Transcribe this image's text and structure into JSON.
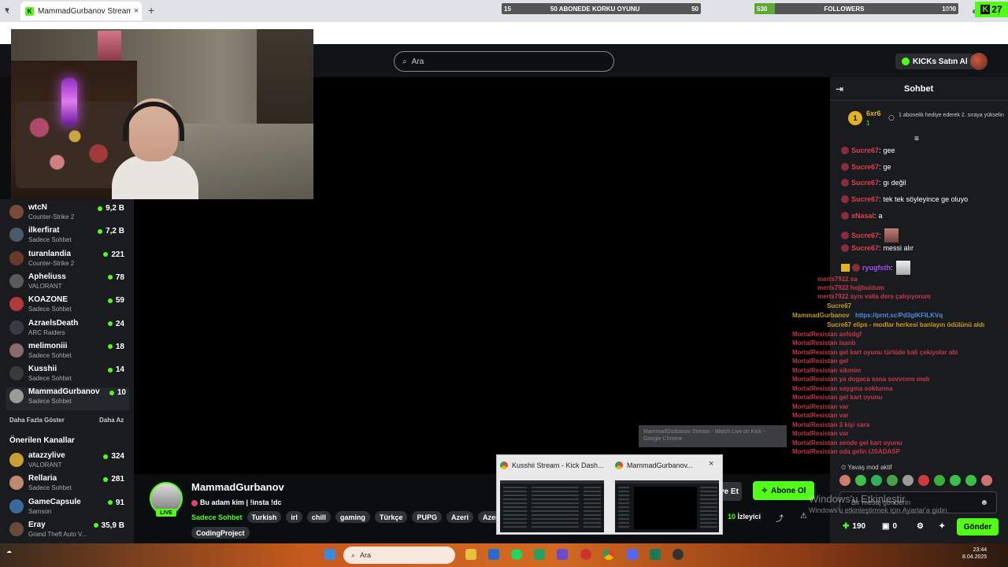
{
  "browser": {
    "tab_title": "MammadGurbanov Stream - W",
    "tab_icon": "kick-favicon",
    "new_tab": "+"
  },
  "overlays": {
    "goal1": {
      "min": "15",
      "label": "50 ABONEDE KORKU OYUNU",
      "max": "50",
      "progress": 0.0
    },
    "goal2": {
      "min": "530",
      "label": "FOLLOWERS",
      "max": "1000",
      "progress": 0.1
    },
    "kick_badge": "27"
  },
  "header": {
    "search_placeholder": "Ara",
    "kicks_button": "KICKs Satın Al"
  },
  "sidebar": {
    "following": [
      {
        "name": "wtcN",
        "category": "Counter-Strike 2",
        "viewers": "9,2 B",
        "avatar": "#7a4a3a"
      },
      {
        "name": "ilkerfirat",
        "category": "Sadece Sohbet",
        "viewers": "7,2 B",
        "avatar": "#4a5a6a"
      },
      {
        "name": "turanlandia",
        "category": "Counter-Strike 2",
        "viewers": "221",
        "avatar": "#6a3a2a"
      },
      {
        "name": "Apheliuss",
        "category": "VALORANT",
        "viewers": "78",
        "avatar": "#5a5a5a"
      },
      {
        "name": "KOAZONE",
        "category": "Sadece Sohbet",
        "viewers": "59",
        "avatar": "#b03a3a"
      },
      {
        "name": "AzraelsDeath",
        "category": "ARC Raiders",
        "viewers": "24",
        "avatar": "#3a3a4a"
      },
      {
        "name": "melimoniii",
        "category": "Sadece Sohbet",
        "viewers": "18",
        "avatar": "#8a6a6a"
      },
      {
        "name": "Kusshii",
        "category": "Sadece Sohbet",
        "viewers": "14",
        "avatar": "#3a3a3a"
      },
      {
        "name": "MammadGurbanov",
        "category": "Sadece Sohbet",
        "viewers": "10",
        "avatar": "#9a9a9a"
      }
    ],
    "show_more": "Daha Fazla Göster",
    "show_less": "Daha Az",
    "recommended_title": "Önerilen Kanallar",
    "recommended": [
      {
        "name": "atazzylive",
        "category": "VALORANT",
        "viewers": "324",
        "avatar": "#c9a030"
      },
      {
        "name": "Rellaria",
        "category": "Sadece Sohbet",
        "viewers": "281",
        "avatar": "#c08a70"
      },
      {
        "name": "GameCapsule",
        "category": "Samson",
        "viewers": "91",
        "avatar": "#3a6a9a"
      },
      {
        "name": "Eray",
        "category": "Grand Theft Auto V...",
        "viewers": "35,9 B",
        "avatar": "#6a4a3a"
      }
    ]
  },
  "stream": {
    "streamer": "MammadGurbanov",
    "live": "LIVE",
    "title": "Bu adam kim | !insta !dc",
    "category": "Sadece Sohbet",
    "tags": [
      "Turkish",
      "irl",
      "chill",
      "gaming",
      "Türkçe",
      "PUPG",
      "Azeri",
      "Azerb"
    ],
    "tag2": "CodingProject",
    "follow_partial": "ye Et",
    "subscribe": "Abone Ol",
    "viewers": "10",
    "viewers_label": "İzleyici"
  },
  "chat": {
    "title": "Sohbet",
    "pinned": {
      "rank": "1",
      "user": "6xr6",
      "count": "1",
      "text": "1 abonelik hediye ederek 2. sıraya yükselin"
    },
    "messages": [
      {
        "user": "Sucre67",
        "text": "gee",
        "emote": ""
      },
      {
        "user": "Sucre67",
        "text": "ge",
        "emote": ""
      },
      {
        "user": "Sucre67",
        "text": "gı değil",
        "emote": ""
      },
      {
        "user": "Sucre67",
        "text": "tek tek söyleyince ge oluyo",
        "emote": ""
      },
      {
        "user": "xNasal",
        "text": "a",
        "emote": ""
      },
      {
        "user": "Sucre67",
        "text": "",
        "emote": "face"
      },
      {
        "user": "Sucre67",
        "text": "messi alır",
        "emote": ""
      },
      {
        "user": "ryugfsth",
        "text": "",
        "emote": "cat"
      }
    ],
    "ghost_lines": [
      {
        "text": "merts7922  sa",
        "cls": "user"
      },
      {
        "text": "merts7922  hojjbuldum",
        "cls": "user"
      },
      {
        "text": "merts7922  aynı valla ders çalışıyorum",
        "cls": "user"
      },
      {
        "text": "Sucre67",
        "cls": "yel"
      },
      {
        "text": "MammadGurbanov",
        "cls": "yel"
      },
      {
        "text": "https://prnt.sc/Pd3glKFILKVq",
        "cls": "lnk"
      },
      {
        "text": "Sucre67   elips - modlar herkesi banlayın ödülünü aldı",
        "cls": "yel"
      },
      {
        "text": "MortalResistan  asfsdgf",
        "cls": "user"
      },
      {
        "text": "MortalResistan  laanb",
        "cls": "user"
      },
      {
        "text": "MortalResistan  gel kart oyunu   türlüde bali çekiyolar abi",
        "cls": "user"
      },
      {
        "text": "MortalResistan  gel",
        "cls": "user"
      },
      {
        "text": "MortalResistan  sikmim",
        "cls": "user"
      },
      {
        "text": "MortalResistan  ya dogaca sana sovvcem ımdı",
        "cls": "user"
      },
      {
        "text": "MortalResistan  saygına sokturma",
        "cls": "user"
      },
      {
        "text": "MortalResistan  gel kart oyunu",
        "cls": "user"
      },
      {
        "text": "MortalResistan  var",
        "cls": "user"
      },
      {
        "text": "MortalResistan  var",
        "cls": "user"
      },
      {
        "text": "MortalResistan  3 kişi sara",
        "cls": "user"
      },
      {
        "text": "MortalResistan  var",
        "cls": "user"
      },
      {
        "text": "MortalResistan  sende gel kart oyunu",
        "cls": "user"
      },
      {
        "text": "MortalResistan  oda gelin   IJSADASP",
        "cls": "user"
      }
    ],
    "slow_mode": "Yavaş mod aktif",
    "input_placeholder": "Bir mesaj gönderin",
    "points": "190",
    "gifts": "0",
    "send": "Gönder"
  },
  "windows": {
    "activation_title": "Windows'u Etkinleştir",
    "activation_sub": "Windows'u etkinleştirmek için Ayarlar'a gidin.",
    "tooltip": "MammadGurbanov Stream - Watch Live on Kick - Google Chrome",
    "preview1_title": "Kusshii Stream - Kick Dash...",
    "preview2_title": "MammadGurbanov...",
    "taskbar_search": "Ara",
    "time": "23:44",
    "date": "8.04.2025"
  }
}
